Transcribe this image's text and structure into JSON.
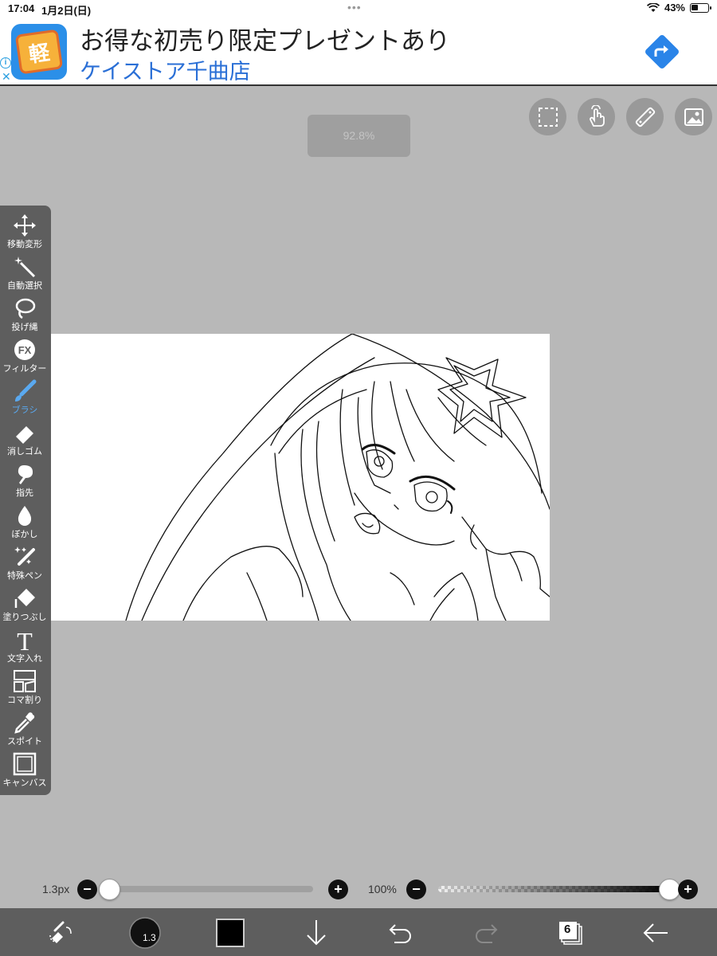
{
  "status_bar": {
    "time": "17:04",
    "date": "1月2日(日)",
    "dots": "•••",
    "battery_percent": "43%",
    "battery_level": 0.43
  },
  "ad": {
    "title": "お得な初売り限定プレゼントあり",
    "subtitle": "ケイストア千曲店",
    "logo_text": "軽",
    "info_glyph": "i",
    "close_glyph": "✕"
  },
  "canvas": {
    "zoom_label": "92.8%"
  },
  "tools": [
    {
      "label": "移動変形",
      "icon": "move-icon"
    },
    {
      "label": "自動選択",
      "icon": "magic-wand-icon"
    },
    {
      "label": "投げ縄",
      "icon": "lasso-icon"
    },
    {
      "label": "フィルター",
      "icon": "fx-icon",
      "icon_text": "FX"
    },
    {
      "label": "ブラシ",
      "icon": "brush-icon",
      "active": true
    },
    {
      "label": "消しゴム",
      "icon": "eraser-icon"
    },
    {
      "label": "指先",
      "icon": "smudge-icon"
    },
    {
      "label": "ぼかし",
      "icon": "blur-icon"
    },
    {
      "label": "特殊ペン",
      "icon": "special-pen-icon"
    },
    {
      "label": "塗りつぶし",
      "icon": "fill-icon"
    },
    {
      "label": "文字入れ",
      "icon": "text-icon",
      "icon_text": "T"
    },
    {
      "label": "コマ割り",
      "icon": "frame-divider-icon"
    },
    {
      "label": "スポイト",
      "icon": "eyedropper-icon"
    },
    {
      "label": "キャンバス",
      "icon": "canvas-icon"
    }
  ],
  "brush": {
    "size_label": "1.3px",
    "size_fraction": 0.0,
    "opacity_label": "100%",
    "opacity_fraction": 1.0,
    "minus": "−",
    "plus": "+"
  },
  "bottom_bar": {
    "brush_size_badge": "1.3",
    "layer_count": "6",
    "color": "#000000"
  },
  "colors": {
    "background": "#b8b8b8",
    "toolbar": "#5e5e5e",
    "active_tool": "#5aa9f0",
    "ad_link": "#2a6fd6"
  }
}
